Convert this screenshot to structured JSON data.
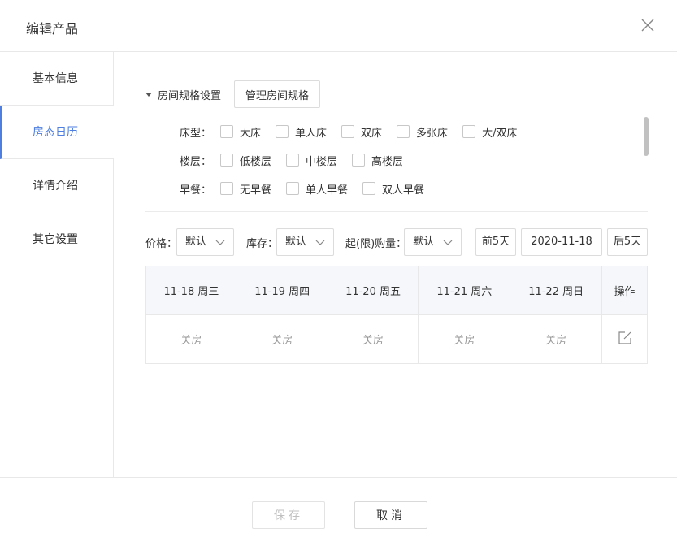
{
  "dialog": {
    "title": "编辑产品"
  },
  "sidebar": {
    "items": [
      {
        "label": "基本信息"
      },
      {
        "label": "房态日历"
      },
      {
        "label": "详情介绍"
      },
      {
        "label": "其它设置"
      }
    ],
    "active_index": 1
  },
  "spec": {
    "title": "房间规格设置",
    "manage_button": "管理房间规格",
    "rows": [
      {
        "label": "床型：",
        "options": [
          "大床",
          "单人床",
          "双床",
          "多张床",
          "大/双床"
        ]
      },
      {
        "label": "楼层：",
        "options": [
          "低楼层",
          "中楼层",
          "高楼层"
        ]
      },
      {
        "label": "早餐：",
        "options": [
          "无早餐",
          "单人早餐",
          "双人早餐"
        ]
      }
    ]
  },
  "filters": {
    "price_label": "价格：",
    "price_value": "默认",
    "stock_label": "库存：",
    "stock_value": "默认",
    "min_buy_label": "起(限)购量：",
    "min_buy_value": "默认",
    "prev_button": "前5天",
    "date_value": "2020-11-18",
    "next_button": "后5天"
  },
  "calendar": {
    "columns": [
      "11-18 周三",
      "11-19 周四",
      "11-20 周五",
      "11-21 周六",
      "11-22 周日",
      "操作"
    ],
    "row": [
      "关房",
      "关房",
      "关房",
      "关房",
      "关房"
    ]
  },
  "footer": {
    "save_label": "保存",
    "cancel_label": "取消"
  },
  "colors": {
    "accent": "#4d7ee0",
    "border": "#e8e8e8",
    "header_bg": "#f5f7fa"
  },
  "icons": {
    "close": "close-icon",
    "caret": "caret-down-icon",
    "chevron": "chevron-down-icon",
    "edit": "edit-icon"
  }
}
